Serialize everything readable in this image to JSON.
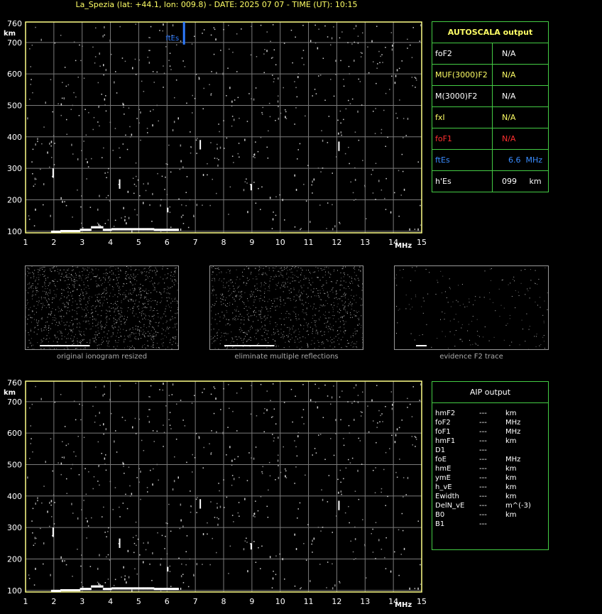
{
  "title": "La_Spezia (lat: +44.1, lon: 009.8) - DATE: 2025 07 07 - TIME (UT): 10:15",
  "ionogram": {
    "y_ticks": [
      "760",
      "700",
      "600",
      "500",
      "400",
      "300",
      "200",
      "100"
    ],
    "y_unit": "km",
    "x_ticks": [
      "1",
      "2",
      "3",
      "4",
      "5",
      "6",
      "7",
      "8",
      "9",
      "10",
      "11",
      "12",
      "13",
      "14",
      "15"
    ],
    "x_unit": "MHz",
    "ftes_marker": "ftEs",
    "ftes_freq": 6.6
  },
  "autoscala": {
    "title": "AUTOSCALA output",
    "rows": [
      {
        "label": "foF2",
        "value": "N/A",
        "label_color": "#ffffff",
        "value_color": "#ffffff"
      },
      {
        "label": "MUF(3000)F2",
        "value": "N/A",
        "label_color": "#ffff66",
        "value_color": "#ffff66"
      },
      {
        "label": "M(3000)F2",
        "value": "N/A",
        "label_color": "#ffffff",
        "value_color": "#ffffff"
      },
      {
        "label": "fxI",
        "value": "N/A",
        "label_color": "#ffff66",
        "value_color": "#ffff66"
      },
      {
        "label": "foF1",
        "value": "N/A",
        "label_color": "#ff3030",
        "value_color": "#ff3030"
      },
      {
        "label": "ftEs",
        "value": "6.6  MHz",
        "label_color": "#3a8cff",
        "value_color": "#3a8cff"
      },
      {
        "label": "h'Es",
        "value": "099     km",
        "label_color": "#ffffff",
        "value_color": "#ffffff"
      }
    ]
  },
  "thumbnails": [
    {
      "caption": "original ionogram resized"
    },
    {
      "caption": "eliminate multiple reflections"
    },
    {
      "caption": "evidence F2 trace"
    }
  ],
  "aip": {
    "title": "AIP output",
    "rows": [
      {
        "name": "hmF2",
        "value": "---",
        "unit": "km"
      },
      {
        "name": "foF2",
        "value": "---",
        "unit": "MHz"
      },
      {
        "name": "foF1",
        "value": "---",
        "unit": "MHz"
      },
      {
        "name": "hmF1",
        "value": "---",
        "unit": "km"
      },
      {
        "name": "D1",
        "value": "---",
        "unit": ""
      },
      {
        "name": "foE",
        "value": "---",
        "unit": "MHz"
      },
      {
        "name": "hmE",
        "value": "---",
        "unit": "km"
      },
      {
        "name": "ymE",
        "value": "---",
        "unit": "km"
      },
      {
        "name": "h_vE",
        "value": "---",
        "unit": "km"
      },
      {
        "name": "Ewidth",
        "value": "---",
        "unit": "km"
      },
      {
        "name": "DelN_vE",
        "value": "---",
        "unit": "m^(-3)"
      },
      {
        "name": "B0",
        "value": "---",
        "unit": "km"
      },
      {
        "name": "B1",
        "value": "---",
        "unit": ""
      }
    ]
  },
  "colors": {
    "grid": "#7a7a7a",
    "axis": "#ffff88",
    "panel_border": "#44cc44",
    "trace": "#ffffff",
    "ftes": "#2e7bff"
  }
}
